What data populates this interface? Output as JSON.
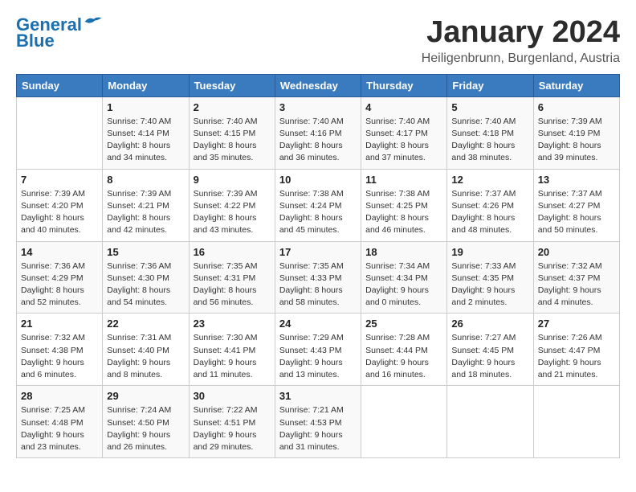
{
  "header": {
    "logo_line1": "General",
    "logo_line2": "Blue",
    "title": "January 2024",
    "subtitle": "Heiligenbrunn, Burgenland, Austria"
  },
  "days_of_week": [
    "Sunday",
    "Monday",
    "Tuesday",
    "Wednesday",
    "Thursday",
    "Friday",
    "Saturday"
  ],
  "weeks": [
    [
      {
        "day": "",
        "sunrise": "",
        "sunset": "",
        "daylight": ""
      },
      {
        "day": "1",
        "sunrise": "7:40 AM",
        "sunset": "4:14 PM",
        "daylight": "8 hours and 34 minutes."
      },
      {
        "day": "2",
        "sunrise": "7:40 AM",
        "sunset": "4:15 PM",
        "daylight": "8 hours and 35 minutes."
      },
      {
        "day": "3",
        "sunrise": "7:40 AM",
        "sunset": "4:16 PM",
        "daylight": "8 hours and 36 minutes."
      },
      {
        "day": "4",
        "sunrise": "7:40 AM",
        "sunset": "4:17 PM",
        "daylight": "8 hours and 37 minutes."
      },
      {
        "day": "5",
        "sunrise": "7:40 AM",
        "sunset": "4:18 PM",
        "daylight": "8 hours and 38 minutes."
      },
      {
        "day": "6",
        "sunrise": "7:39 AM",
        "sunset": "4:19 PM",
        "daylight": "8 hours and 39 minutes."
      }
    ],
    [
      {
        "day": "7",
        "sunrise": "7:39 AM",
        "sunset": "4:20 PM",
        "daylight": "8 hours and 40 minutes."
      },
      {
        "day": "8",
        "sunrise": "7:39 AM",
        "sunset": "4:21 PM",
        "daylight": "8 hours and 42 minutes."
      },
      {
        "day": "9",
        "sunrise": "7:39 AM",
        "sunset": "4:22 PM",
        "daylight": "8 hours and 43 minutes."
      },
      {
        "day": "10",
        "sunrise": "7:38 AM",
        "sunset": "4:24 PM",
        "daylight": "8 hours and 45 minutes."
      },
      {
        "day": "11",
        "sunrise": "7:38 AM",
        "sunset": "4:25 PM",
        "daylight": "8 hours and 46 minutes."
      },
      {
        "day": "12",
        "sunrise": "7:37 AM",
        "sunset": "4:26 PM",
        "daylight": "8 hours and 48 minutes."
      },
      {
        "day": "13",
        "sunrise": "7:37 AM",
        "sunset": "4:27 PM",
        "daylight": "8 hours and 50 minutes."
      }
    ],
    [
      {
        "day": "14",
        "sunrise": "7:36 AM",
        "sunset": "4:29 PM",
        "daylight": "8 hours and 52 minutes."
      },
      {
        "day": "15",
        "sunrise": "7:36 AM",
        "sunset": "4:30 PM",
        "daylight": "8 hours and 54 minutes."
      },
      {
        "day": "16",
        "sunrise": "7:35 AM",
        "sunset": "4:31 PM",
        "daylight": "8 hours and 56 minutes."
      },
      {
        "day": "17",
        "sunrise": "7:35 AM",
        "sunset": "4:33 PM",
        "daylight": "8 hours and 58 minutes."
      },
      {
        "day": "18",
        "sunrise": "7:34 AM",
        "sunset": "4:34 PM",
        "daylight": "9 hours and 0 minutes."
      },
      {
        "day": "19",
        "sunrise": "7:33 AM",
        "sunset": "4:35 PM",
        "daylight": "9 hours and 2 minutes."
      },
      {
        "day": "20",
        "sunrise": "7:32 AM",
        "sunset": "4:37 PM",
        "daylight": "9 hours and 4 minutes."
      }
    ],
    [
      {
        "day": "21",
        "sunrise": "7:32 AM",
        "sunset": "4:38 PM",
        "daylight": "9 hours and 6 minutes."
      },
      {
        "day": "22",
        "sunrise": "7:31 AM",
        "sunset": "4:40 PM",
        "daylight": "9 hours and 8 minutes."
      },
      {
        "day": "23",
        "sunrise": "7:30 AM",
        "sunset": "4:41 PM",
        "daylight": "9 hours and 11 minutes."
      },
      {
        "day": "24",
        "sunrise": "7:29 AM",
        "sunset": "4:43 PM",
        "daylight": "9 hours and 13 minutes."
      },
      {
        "day": "25",
        "sunrise": "7:28 AM",
        "sunset": "4:44 PM",
        "daylight": "9 hours and 16 minutes."
      },
      {
        "day": "26",
        "sunrise": "7:27 AM",
        "sunset": "4:45 PM",
        "daylight": "9 hours and 18 minutes."
      },
      {
        "day": "27",
        "sunrise": "7:26 AM",
        "sunset": "4:47 PM",
        "daylight": "9 hours and 21 minutes."
      }
    ],
    [
      {
        "day": "28",
        "sunrise": "7:25 AM",
        "sunset": "4:48 PM",
        "daylight": "9 hours and 23 minutes."
      },
      {
        "day": "29",
        "sunrise": "7:24 AM",
        "sunset": "4:50 PM",
        "daylight": "9 hours and 26 minutes."
      },
      {
        "day": "30",
        "sunrise": "7:22 AM",
        "sunset": "4:51 PM",
        "daylight": "9 hours and 29 minutes."
      },
      {
        "day": "31",
        "sunrise": "7:21 AM",
        "sunset": "4:53 PM",
        "daylight": "9 hours and 31 minutes."
      },
      {
        "day": "",
        "sunrise": "",
        "sunset": "",
        "daylight": ""
      },
      {
        "day": "",
        "sunrise": "",
        "sunset": "",
        "daylight": ""
      },
      {
        "day": "",
        "sunrise": "",
        "sunset": "",
        "daylight": ""
      }
    ]
  ],
  "labels": {
    "sunrise": "Sunrise:",
    "sunset": "Sunset:",
    "daylight": "Daylight:"
  }
}
